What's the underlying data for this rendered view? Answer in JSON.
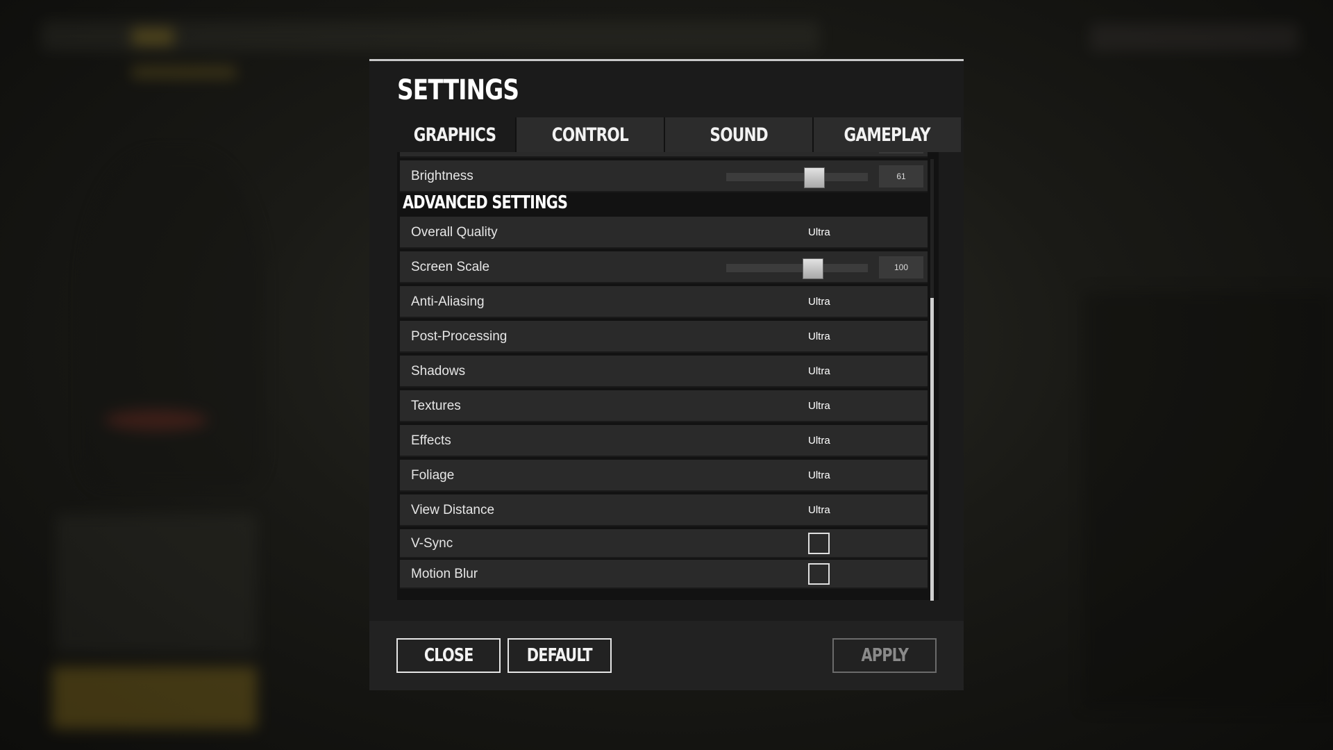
{
  "settings": {
    "title": "SETTINGS",
    "tabs": [
      "GRAPHICS",
      "CONTROL",
      "SOUND",
      "GAMEPLAY"
    ],
    "active_tab": "GRAPHICS",
    "brightness": {
      "label": "Brightness",
      "value": "61"
    },
    "advanced_header": "ADVANCED SETTINGS",
    "rows": {
      "overall_quality": {
        "label": "Overall Quality",
        "value": "Ultra"
      },
      "screen_scale": {
        "label": "Screen Scale",
        "value": "100"
      },
      "anti_aliasing": {
        "label": "Anti-Aliasing",
        "value": "Ultra"
      },
      "post_processing": {
        "label": "Post-Processing",
        "value": "Ultra"
      },
      "shadows": {
        "label": "Shadows",
        "value": "Ultra"
      },
      "textures": {
        "label": "Textures",
        "value": "Ultra"
      },
      "effects": {
        "label": "Effects",
        "value": "Ultra"
      },
      "foliage": {
        "label": "Foliage",
        "value": "Ultra"
      },
      "view_distance": {
        "label": "View Distance",
        "value": "Ultra"
      },
      "v_sync": {
        "label": "V-Sync",
        "checked": false
      },
      "motion_blur": {
        "label": "Motion Blur",
        "checked": false
      }
    },
    "buttons": {
      "close": "CLOSE",
      "default": "DEFAULT",
      "apply": "APPLY"
    }
  },
  "colors": {
    "panel": "#1b1b1b",
    "row": "#2a2a2a",
    "accent_bg": "#a5861f"
  }
}
